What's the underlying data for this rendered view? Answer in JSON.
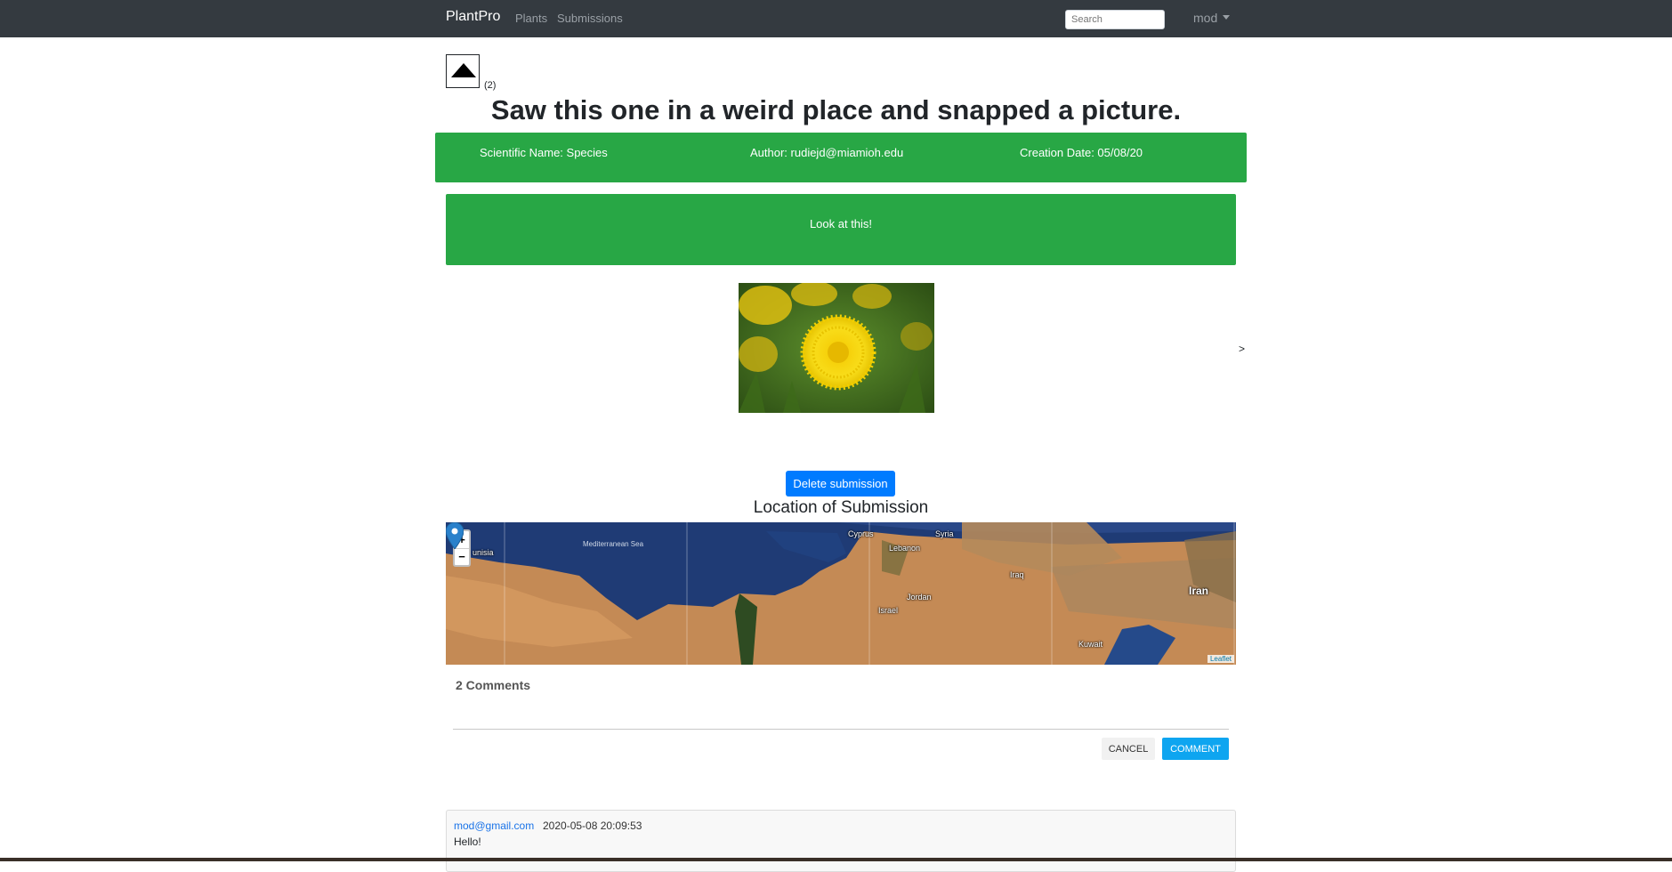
{
  "navbar": {
    "brand": "PlantPro",
    "links": [
      "Plants",
      "Submissions"
    ],
    "search_placeholder": "Search",
    "user": "mod"
  },
  "vote": {
    "count": "(2)",
    "icon": "upvote-triangle-icon"
  },
  "submission": {
    "title": "Saw this one in a weird place and snapped a picture.",
    "scientific_name": "Scientific Name: Species",
    "author": "Author: rudiejd@miamioh.edu",
    "creation_date": "Creation Date: 05/08/20",
    "description": "Look at this!",
    "photo": "dandelion-flower-photo",
    "carousel_next": ">",
    "delete_label": "Delete submission"
  },
  "location": {
    "title": "Location of Submission",
    "zoom_in": "+",
    "zoom_out": "−",
    "attribution": "Leaflet",
    "labels": {
      "tunisia": "unisia",
      "sea": "Mediterranean Sea",
      "cyprus": "Cyprus",
      "syria": "Syria",
      "lebanon": "Lebanon",
      "iraq": "Iraq",
      "jordan": "Jordan",
      "israel": "Israel",
      "iran": "Iran",
      "kuwait": "Kuwait"
    }
  },
  "comments": {
    "count_label": "2 Comments",
    "cancel_label": "CANCEL",
    "comment_label": "COMMENT",
    "items": [
      {
        "author": "mod@gmail.com",
        "date": "2020-05-08 20:09:53",
        "body": "Hello!"
      }
    ]
  },
  "colors": {
    "navbar": "#343a40",
    "success": "#28a745",
    "primary": "#007bff",
    "comment_button": "#0ea5f0"
  }
}
